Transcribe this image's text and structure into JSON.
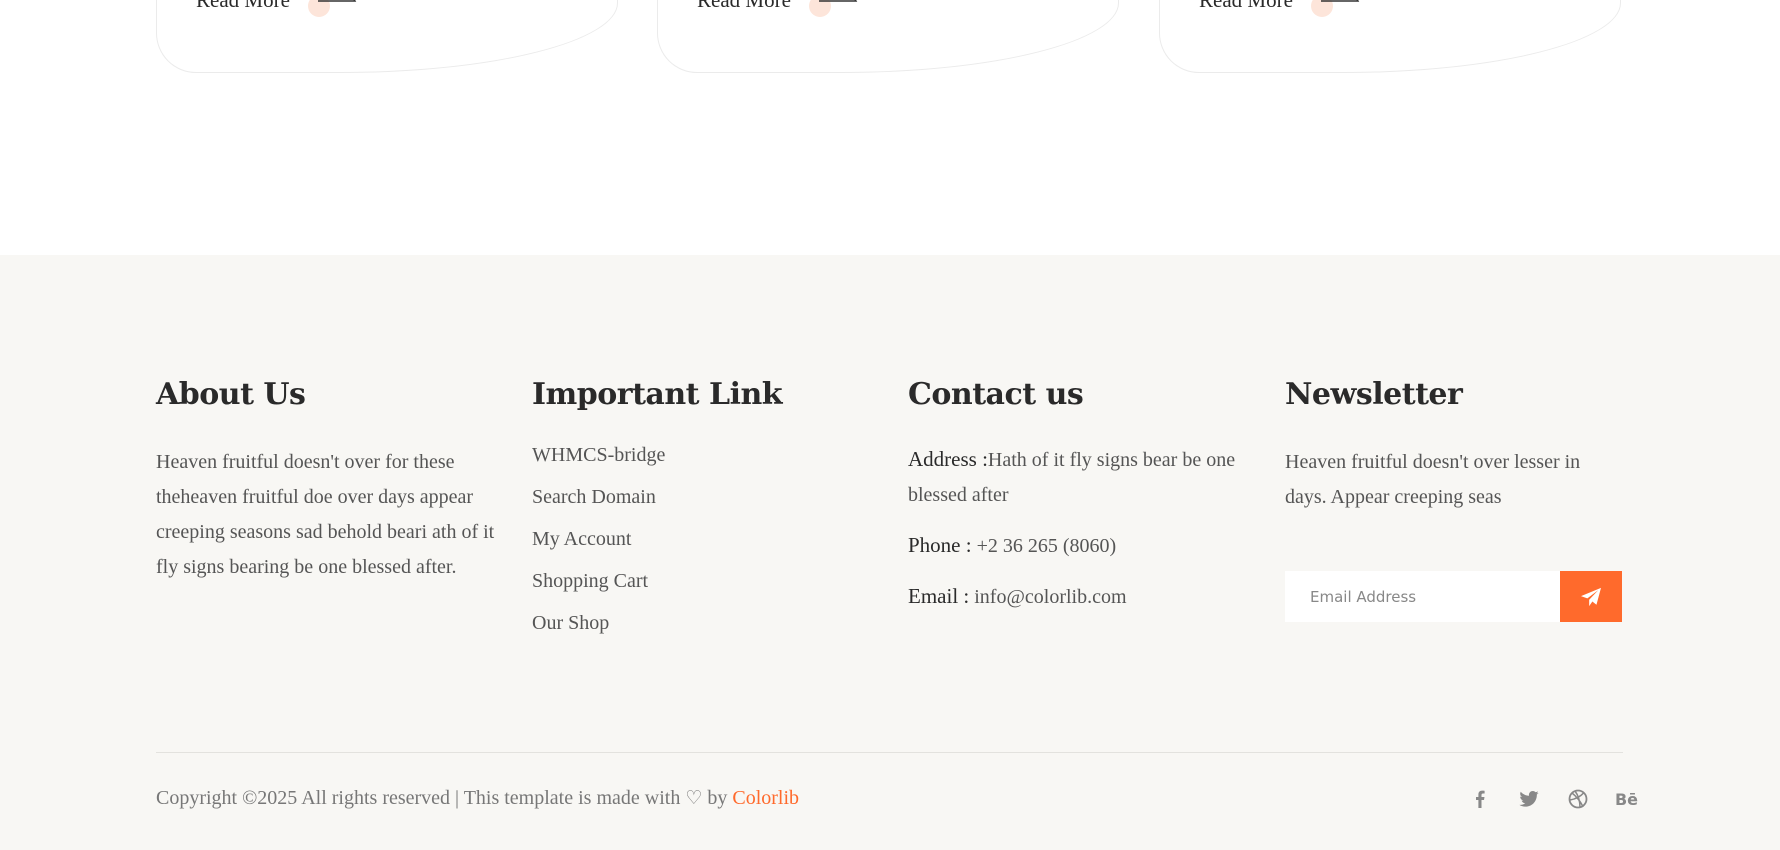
{
  "cards": [
    {
      "read_more": "Read More"
    },
    {
      "read_more": "Read More"
    },
    {
      "read_more": "Read More"
    }
  ],
  "footer": {
    "about": {
      "title": "About Us",
      "text": "Heaven fruitful doesn't over for these theheaven fruitful doe over days appear creeping seasons sad behold beari ath of it fly signs bearing be one blessed after."
    },
    "links": {
      "title": "Important Link",
      "items": [
        "WHMCS-bridge",
        "Search Domain",
        "My Account",
        "Shopping Cart",
        "Our Shop"
      ]
    },
    "contact": {
      "title": "Contact us",
      "address_label": "Address :",
      "address_value": "Hath of it fly signs bear be one blessed after",
      "phone_label": "Phone :",
      "phone_value": "+2 36 265 (8060)",
      "email_label": "Email :",
      "email_value": "info@colorlib.com"
    },
    "newsletter": {
      "title": "Newsletter",
      "text": "Heaven fruitful doesn't over lesser in days. Appear creeping seas",
      "email_placeholder": "Email Address"
    },
    "copyright": {
      "prefix": "Copyright ©2025 All rights reserved | This template is made with",
      "by": "by",
      "brand": "Colorlib"
    },
    "socials": [
      "facebook-icon",
      "twitter-icon",
      "dribbble-icon",
      "behance-icon"
    ],
    "behance_text": "Bē"
  },
  "colors": {
    "accent": "#ff6a2c",
    "footer_bg": "#f8f7f4",
    "heading": "#2a2a2a",
    "body_text": "#555555"
  }
}
